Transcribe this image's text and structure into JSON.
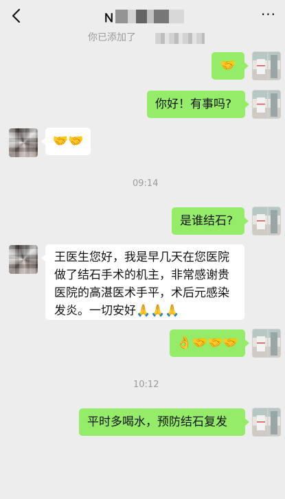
{
  "header": {
    "back_icon": "chevron-left-icon",
    "title_visible": "Ｎ",
    "more_icon": "more-dots-icon",
    "more_glyph": "···"
  },
  "system_notice": "你已添加了",
  "messages": [
    {
      "side": "me",
      "text": "🤝"
    },
    {
      "side": "me",
      "text": "你好！有事吗?"
    },
    {
      "side": "other",
      "text": "🤝🤝"
    },
    {
      "type": "time",
      "text": "09:14"
    },
    {
      "side": "me",
      "text": "是谁结石?"
    },
    {
      "side": "other",
      "text": "王医生您好，我是早几天在您医院做了结石手术的机主，非常感谢贵医院的高湛医术手平，术后元感染发炎。一切安好🙏🙏🙏"
    },
    {
      "side": "me",
      "text": "👌🤝🤝🤝"
    },
    {
      "type": "time",
      "text": "10:12"
    },
    {
      "side": "me",
      "text": "平时多喝水，预防结石复发"
    }
  ],
  "colors": {
    "background": "#ededed",
    "my_bubble": "#95ec69",
    "other_bubble": "#ffffff",
    "meta_text": "#9a9a9a"
  }
}
